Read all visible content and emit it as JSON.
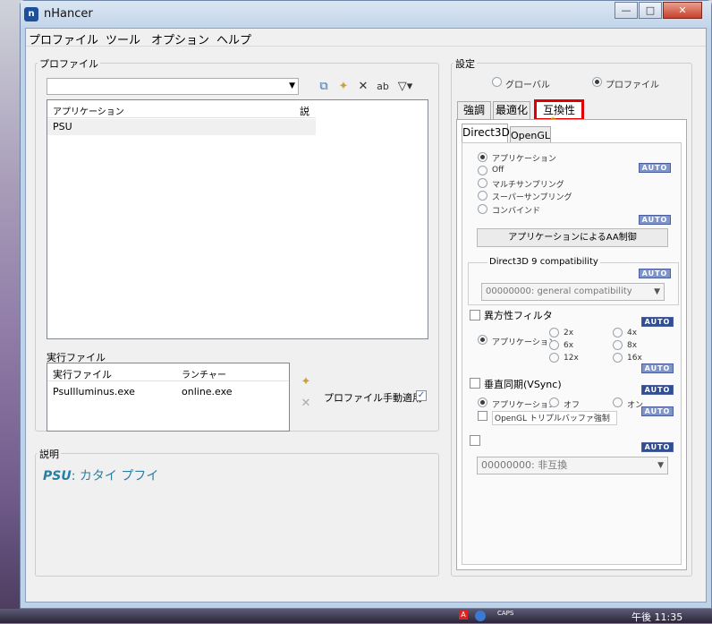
{
  "window": {
    "title": "nHancer",
    "minimize": "—",
    "maximize": "□",
    "close": "✕"
  },
  "menu": [
    "プロファイル",
    "ツール",
    "オプション",
    "ヘルプ"
  ],
  "profiles": {
    "group_label": "プロファイル",
    "columns": [
      "アプリケーション",
      "説"
    ],
    "rows": [
      "PSU"
    ]
  },
  "exe": {
    "group_label": "実行ファイル",
    "columns": [
      "実行ファイル",
      "ランチャー"
    ],
    "rows": [
      {
        "exe": "PsuIlluminus.exe",
        "launcher": "online.exe"
      }
    ],
    "manual_label": "プロファイル手動適用"
  },
  "description": {
    "group_label": "説明",
    "name": "PSU",
    "text": ": カタイ プフイ"
  },
  "settings": {
    "group_label": "設定",
    "scope": [
      "グローバル",
      "プロファイル"
    ],
    "tabs": [
      "強調",
      "最適化",
      "互換性"
    ],
    "subtabs": [
      "Direct3D",
      "OpenGL"
    ],
    "aa_options": [
      "アプリケーション",
      "Off",
      "マルチサンプリング",
      "スーパーサンプリング",
      "コンバインド"
    ],
    "aa_button": "アプリケーションによるAA制御",
    "d3d9_label": "Direct3D 9 compatibility",
    "d3d9_value": "00000000: general compatibility",
    "aniso_label": "異方性フィルタ",
    "aniso_options": [
      "アプリケーション",
      "2x",
      "4x",
      "6x",
      "8x",
      "12x",
      "16x"
    ],
    "vsync_label": "垂直同期(VSync)",
    "vsync_options": [
      "アプリケーション",
      "オフ",
      "オン"
    ],
    "opengl_triple": "OpenGL トリプルバッファ強制",
    "sli_value": "00000000: 非互換",
    "auto_label": "AUTO"
  },
  "taskbar": {
    "caps": "CAPS",
    "clock": "午後 11:35"
  }
}
